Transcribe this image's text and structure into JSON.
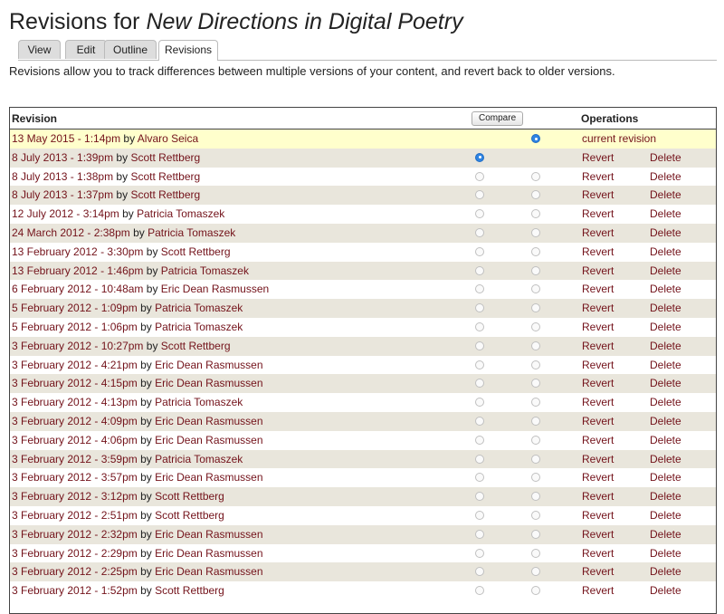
{
  "page": {
    "title_prefix": "Revisions for ",
    "title_node": "New Directions in Digital Poetry",
    "tabs": [
      "View",
      "Edit",
      "Outline",
      "Revisions"
    ],
    "active_tab": "Revisions",
    "description": "Revisions allow you to track differences between multiple versions of your content, and revert back to older versions."
  },
  "table": {
    "header_revision": "Revision",
    "compare_label": "Compare",
    "header_operations": "Operations",
    "by_label": "by",
    "revert_label": "Revert",
    "delete_label": "Delete",
    "current_label": "current revision",
    "rows": [
      {
        "date": "13 May 2015 - 1:14pm",
        "author": "Alvaro Seica"
      },
      {
        "date": "8 July 2013 - 1:39pm",
        "author": "Scott Rettberg"
      },
      {
        "date": "8 July 2013 - 1:38pm",
        "author": "Scott Rettberg"
      },
      {
        "date": "8 July 2013 - 1:37pm",
        "author": "Scott Rettberg"
      },
      {
        "date": "12 July 2012 - 3:14pm",
        "author": "Patricia Tomaszek"
      },
      {
        "date": "24 March 2012 - 2:38pm",
        "author": "Patricia Tomaszek"
      },
      {
        "date": "13 February 2012 - 3:30pm",
        "author": "Scott Rettberg"
      },
      {
        "date": "13 February 2012 - 1:46pm",
        "author": "Patricia Tomaszek"
      },
      {
        "date": "6 February 2012 - 10:48am",
        "author": "Eric Dean Rasmussen"
      },
      {
        "date": "5 February 2012 - 1:09pm",
        "author": "Patricia Tomaszek"
      },
      {
        "date": "5 February 2012 - 1:06pm",
        "author": "Patricia Tomaszek"
      },
      {
        "date": "3 February 2012 - 10:27pm",
        "author": "Scott Rettberg"
      },
      {
        "date": "3 February 2012 - 4:21pm",
        "author": "Eric Dean Rasmussen"
      },
      {
        "date": "3 February 2012 - 4:15pm",
        "author": "Eric Dean Rasmussen"
      },
      {
        "date": "3 February 2012 - 4:13pm",
        "author": "Patricia Tomaszek"
      },
      {
        "date": "3 February 2012 - 4:09pm",
        "author": "Eric Dean Rasmussen"
      },
      {
        "date": "3 February 2012 - 4:06pm",
        "author": "Eric Dean Rasmussen"
      },
      {
        "date": "3 February 2012 - 3:59pm",
        "author": "Patricia Tomaszek"
      },
      {
        "date": "3 February 2012 - 3:57pm",
        "author": "Eric Dean Rasmussen"
      },
      {
        "date": "3 February 2012 - 3:12pm",
        "author": "Scott Rettberg"
      },
      {
        "date": "3 February 2012 - 2:51pm",
        "author": "Scott Rettberg"
      },
      {
        "date": "3 February 2012 - 2:32pm",
        "author": "Eric Dean Rasmussen"
      },
      {
        "date": "3 February 2012 - 2:29pm",
        "author": "Eric Dean Rasmussen"
      },
      {
        "date": "3 February 2012 - 2:25pm",
        "author": "Eric Dean Rasmussen"
      },
      {
        "date": "3 February 2012 - 1:52pm",
        "author": "Scott Rettberg"
      }
    ],
    "selected_left_row": 1,
    "selected_right_row": 0
  },
  "colors": {
    "link": "#73121a",
    "row_even": "#e9e6dc",
    "row_current": "#ffffcc",
    "radio_checked": "#2f84e2"
  },
  "icons": {
    "radio": "radio-button-icon"
  }
}
